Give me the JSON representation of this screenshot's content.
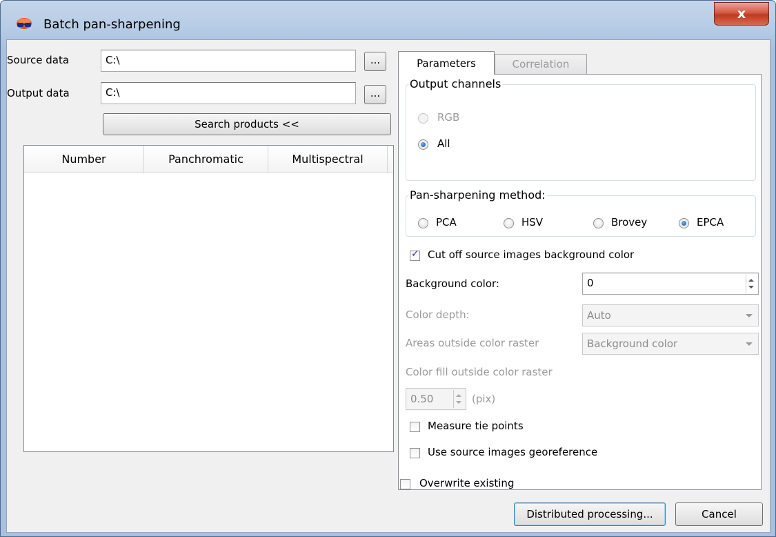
{
  "window": {
    "title": "Batch pan-sharpening",
    "close_glyph": "x"
  },
  "left": {
    "source_label": "Source data",
    "source_value": "C:\\",
    "output_label": "Output data",
    "output_value": "C:\\",
    "browse_label": "...",
    "search_button": "Search products <<",
    "columns": [
      "Number",
      "Panchromatic",
      "Multispectral"
    ]
  },
  "tabs": [
    {
      "label": "Parameters",
      "active": true
    },
    {
      "label": "Correlation",
      "active": false
    }
  ],
  "params": {
    "output_channels_title": "Output channels",
    "rgb_label": "RGB",
    "all_label": "All",
    "method_title": "Pan-sharpening method:",
    "methods": [
      "PCA",
      "HSV",
      "Brovey",
      "EPCA"
    ],
    "selected_method": "EPCA",
    "cut_off_label": "Cut off source images background color",
    "cut_off_checked": true,
    "bg_color_label": "Background color:",
    "bg_color_value": "0",
    "color_depth_label": "Color depth:",
    "color_depth_value": "Auto",
    "areas_label": "Areas outside color raster",
    "areas_value": "Background color",
    "color_fill_label": "Color fill outside color raster",
    "fill_value": "0.50",
    "fill_unit": "(pix)",
    "measure_label": "Measure tie points",
    "measure_checked": false,
    "georef_label": "Use source images georeference",
    "georef_checked": false
  },
  "footer": {
    "overwrite_label": "Overwrite existing",
    "overwrite_checked": false,
    "distributed_button": "Distributed processing...",
    "cancel_button": "Cancel"
  },
  "colors": {
    "accent": "#3399ff",
    "title_bar": "#b9cee7",
    "close_red": "#c7402a"
  }
}
